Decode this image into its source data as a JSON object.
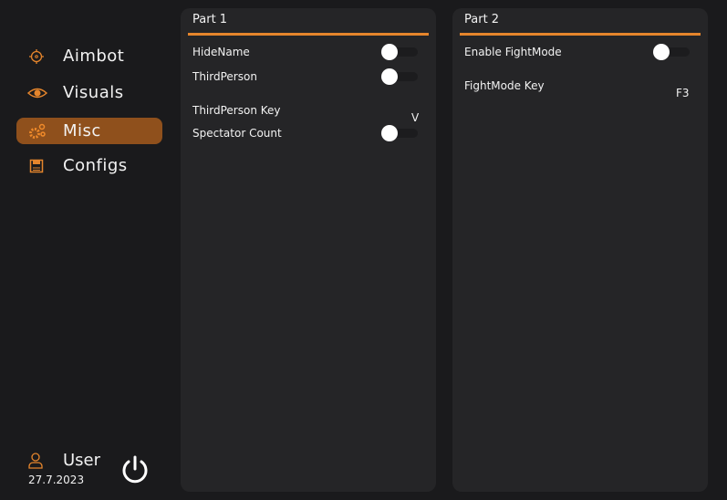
{
  "sidebar": {
    "items": [
      {
        "label": "Aimbot",
        "icon": "crosshair-icon"
      },
      {
        "label": "Visuals",
        "icon": "eye-icon"
      },
      {
        "label": "Misc",
        "icon": "gears-icon",
        "active": true
      },
      {
        "label": "Configs",
        "icon": "save-icon"
      }
    ],
    "user": {
      "name": "User",
      "date": "27.7.2023"
    }
  },
  "accent": "#e5852c",
  "part1": {
    "title": "Part 1",
    "hide_name": "HideName",
    "hide_name_on": false,
    "third_person": "ThirdPerson",
    "third_person_on": false,
    "third_person_key_label": "ThirdPerson Key",
    "third_person_key": "V",
    "spectator": "Spectator Count",
    "spectator_on": false
  },
  "part2": {
    "title": "Part 2",
    "fightmode": "Enable FightMode",
    "fightmode_on": false,
    "fightmode_key_label": "FightMode Key",
    "fightmode_key": "F3"
  }
}
